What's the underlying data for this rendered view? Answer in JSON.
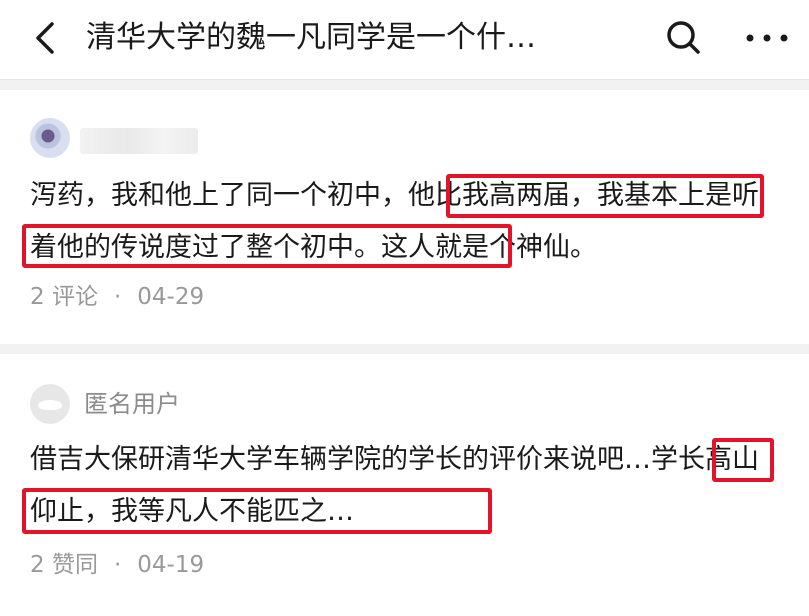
{
  "header": {
    "title": "清华大学的魏一凡同学是一个什…",
    "back_icon": "chevron-left-icon",
    "search_icon": "search-icon",
    "more_icon": "more-horizontal-icon"
  },
  "comments": [
    {
      "author": "",
      "text": "泻药，我和他上了同一个初中，他比我高两届，我基本上是听着他的传说度过了整个初中。这人就是个神仙。",
      "stat": "2 评论",
      "separator": "·",
      "date": "04-29"
    },
    {
      "author": "匿名用户",
      "text": "借吉大保研清华大学车辆学院的学长的评价来说吧…学长高山仰止，我等凡人不能匹之…",
      "stat": "2 赞同",
      "separator": "·",
      "date": "04-19"
    }
  ],
  "colors": {
    "highlight": "#e3132b",
    "meta_text": "#999999",
    "background": "#f2f2f2"
  }
}
